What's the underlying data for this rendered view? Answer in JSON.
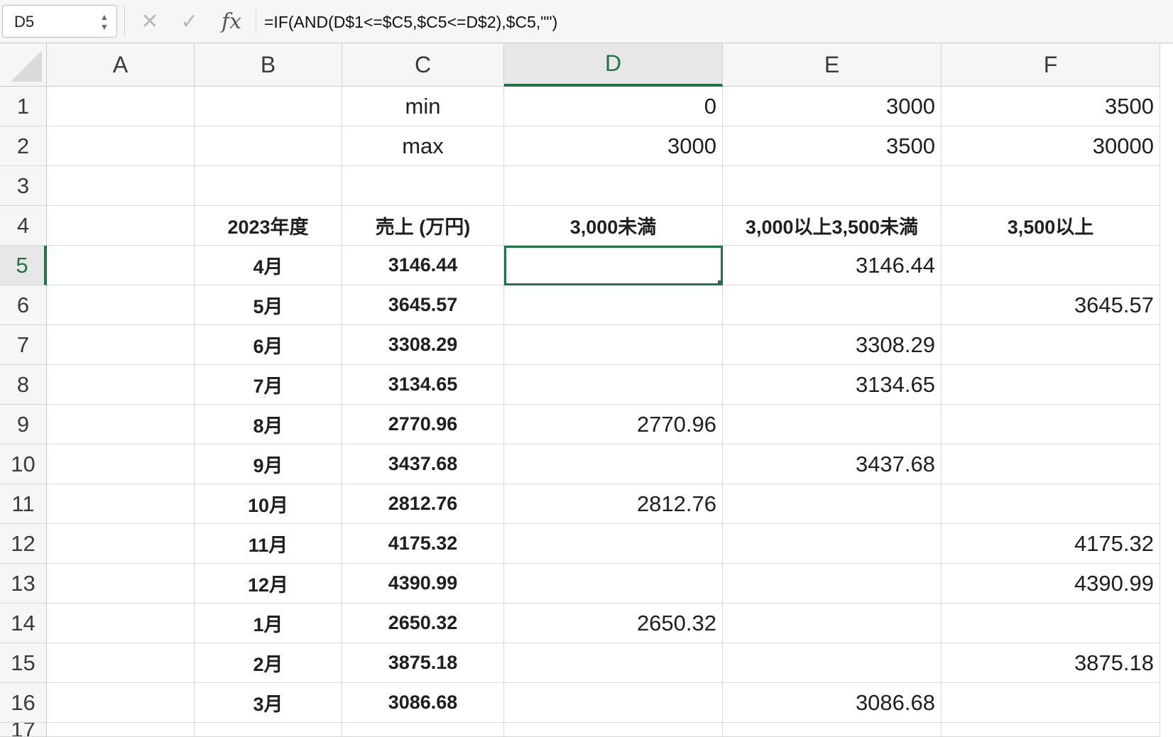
{
  "formula_bar": {
    "name_box": "D5",
    "cancel_glyph": "✕",
    "enter_glyph": "✓",
    "fx_label": "fx",
    "formula": "=IF(AND(D$1<=$C5,$C5<=D$2),$C5,\"\")"
  },
  "columns": [
    "A",
    "B",
    "C",
    "D",
    "E",
    "F"
  ],
  "selection": {
    "cell": "D5",
    "accent": "#217346"
  },
  "rows": [
    {
      "num": "1",
      "A": "",
      "B": "",
      "C": "min",
      "D": "0",
      "E": "3000",
      "F": "3500"
    },
    {
      "num": "2",
      "A": "",
      "B": "",
      "C": "max",
      "D": "3000",
      "E": "3500",
      "F": "30000"
    },
    {
      "num": "3",
      "A": "",
      "B": "",
      "C": "",
      "D": "",
      "E": "",
      "F": ""
    },
    {
      "num": "4",
      "A": "",
      "B": "2023年度",
      "C": "売上 (万円)",
      "D": "3,000未満",
      "E": "3,000以上3,500未満",
      "F": "3,500以上"
    },
    {
      "num": "5",
      "A": "",
      "B": "4月",
      "C": "3146.44",
      "D": "",
      "E": "3146.44",
      "F": ""
    },
    {
      "num": "6",
      "A": "",
      "B": "5月",
      "C": "3645.57",
      "D": "",
      "E": "",
      "F": "3645.57"
    },
    {
      "num": "7",
      "A": "",
      "B": "6月",
      "C": "3308.29",
      "D": "",
      "E": "3308.29",
      "F": ""
    },
    {
      "num": "8",
      "A": "",
      "B": "7月",
      "C": "3134.65",
      "D": "",
      "E": "3134.65",
      "F": ""
    },
    {
      "num": "9",
      "A": "",
      "B": "8月",
      "C": "2770.96",
      "D": "2770.96",
      "E": "",
      "F": ""
    },
    {
      "num": "10",
      "A": "",
      "B": "9月",
      "C": "3437.68",
      "D": "",
      "E": "3437.68",
      "F": ""
    },
    {
      "num": "11",
      "A": "",
      "B": "10月",
      "C": "2812.76",
      "D": "2812.76",
      "E": "",
      "F": ""
    },
    {
      "num": "12",
      "A": "",
      "B": "11月",
      "C": "4175.32",
      "D": "",
      "E": "",
      "F": "4175.32"
    },
    {
      "num": "13",
      "A": "",
      "B": "12月",
      "C": "4390.99",
      "D": "",
      "E": "",
      "F": "4390.99"
    },
    {
      "num": "14",
      "A": "",
      "B": "1月",
      "C": "2650.32",
      "D": "2650.32",
      "E": "",
      "F": ""
    },
    {
      "num": "15",
      "A": "",
      "B": "2月",
      "C": "3875.18",
      "D": "",
      "E": "",
      "F": "3875.18"
    },
    {
      "num": "16",
      "A": "",
      "B": "3月",
      "C": "3086.68",
      "D": "",
      "E": "3086.68",
      "F": ""
    },
    {
      "num": "17",
      "A": "",
      "B": "",
      "C": "",
      "D": "",
      "E": "",
      "F": ""
    }
  ]
}
